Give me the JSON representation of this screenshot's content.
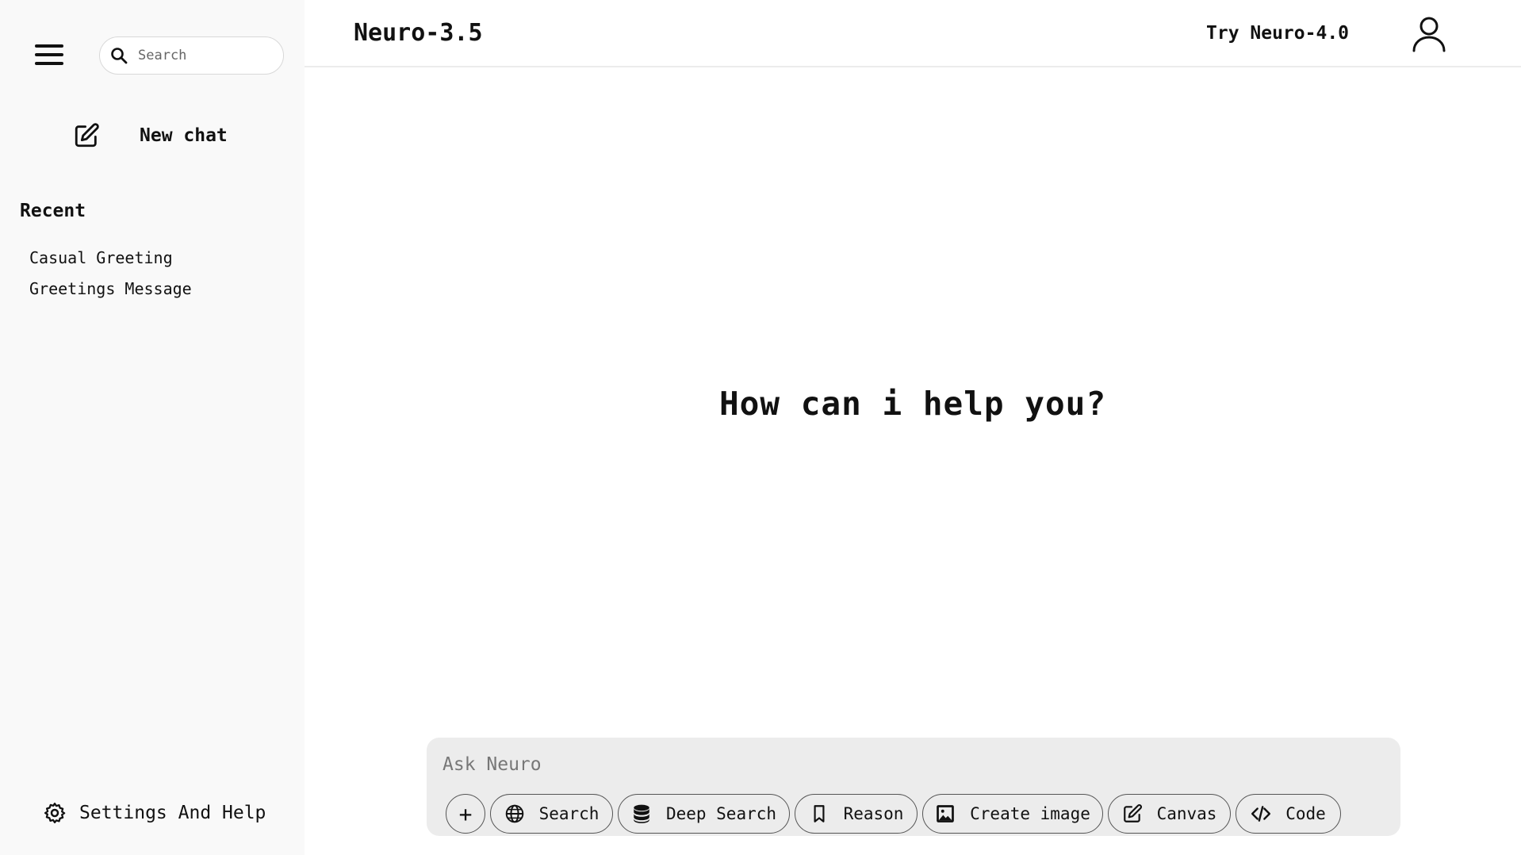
{
  "sidebar": {
    "menu_icon": "hamburger-menu-icon",
    "search": {
      "placeholder": "Search",
      "icon": "search-icon"
    },
    "new_chat": {
      "label": "New chat",
      "icon": "edit-icon"
    },
    "recent": {
      "title": "Recent",
      "items": [
        {
          "label": "Casual Greeting"
        },
        {
          "label": "Greetings Message"
        }
      ]
    },
    "settings": {
      "label": "Settings And Help",
      "icon": "gear-icon"
    }
  },
  "header": {
    "model_name": "Neuro-3.5",
    "try_label": "Try Neuro-4.0",
    "user_icon": "user-icon"
  },
  "main": {
    "greeting": "How can i help you?"
  },
  "composer": {
    "placeholder": "Ask Neuro",
    "add_label": "+",
    "tools": [
      {
        "label": "Search",
        "icon": "globe-icon"
      },
      {
        "label": "Deep Search",
        "icon": "database-icon"
      },
      {
        "label": "Reason",
        "icon": "bookmark-icon"
      },
      {
        "label": "Create image",
        "icon": "image-icon"
      },
      {
        "label": "Canvas",
        "icon": "edit-icon"
      },
      {
        "label": "Code",
        "icon": "code-icon"
      }
    ]
  },
  "colors": {
    "sidebar_bg": "#f9f9f9",
    "composer_bg": "#ececec",
    "text": "#111111"
  }
}
